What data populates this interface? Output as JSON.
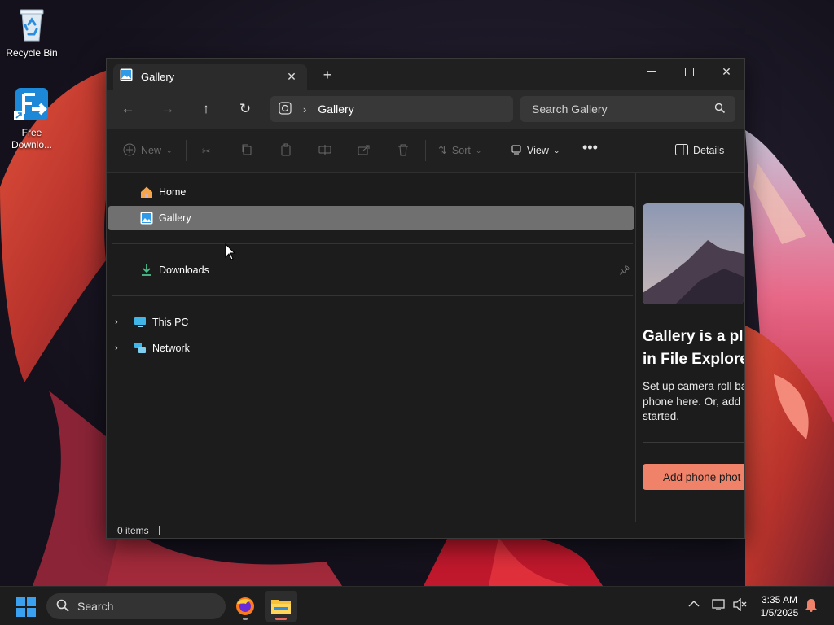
{
  "desktop": {
    "icons": [
      {
        "label": "Recycle Bin"
      },
      {
        "label": "Free Downlo..."
      }
    ]
  },
  "window": {
    "tab_title": "Gallery",
    "address": {
      "current": "Gallery"
    },
    "search": {
      "placeholder": "Search Gallery"
    },
    "toolbar": {
      "new_label": "New",
      "sort_label": "Sort",
      "view_label": "View",
      "details_label": "Details"
    },
    "nav": {
      "items": [
        {
          "label": "Home"
        },
        {
          "label": "Gallery",
          "selected": true
        },
        {
          "label": "Downloads",
          "pinned": true
        },
        {
          "label": "This PC",
          "expandable": true
        },
        {
          "label": "Network",
          "expandable": true
        }
      ]
    },
    "details_pane": {
      "heading": "Gallery is a pla in File Explore",
      "heading_line1": "Gallery is a pla",
      "heading_line2": "in File Explore",
      "body_line1": "Set up camera roll ba",
      "body_line2": "phone here. Or, add",
      "body_line3": "started.",
      "button_label": "Add phone phot"
    },
    "status": {
      "items_text": "0 items"
    }
  },
  "taskbar": {
    "search_label": "Search",
    "clock": {
      "time": "3:35 AM",
      "date": "1/5/2025"
    }
  },
  "colors": {
    "accent_button": "#f0826a",
    "selection": "#707070",
    "explorer_indicator": "#e66a5c"
  }
}
